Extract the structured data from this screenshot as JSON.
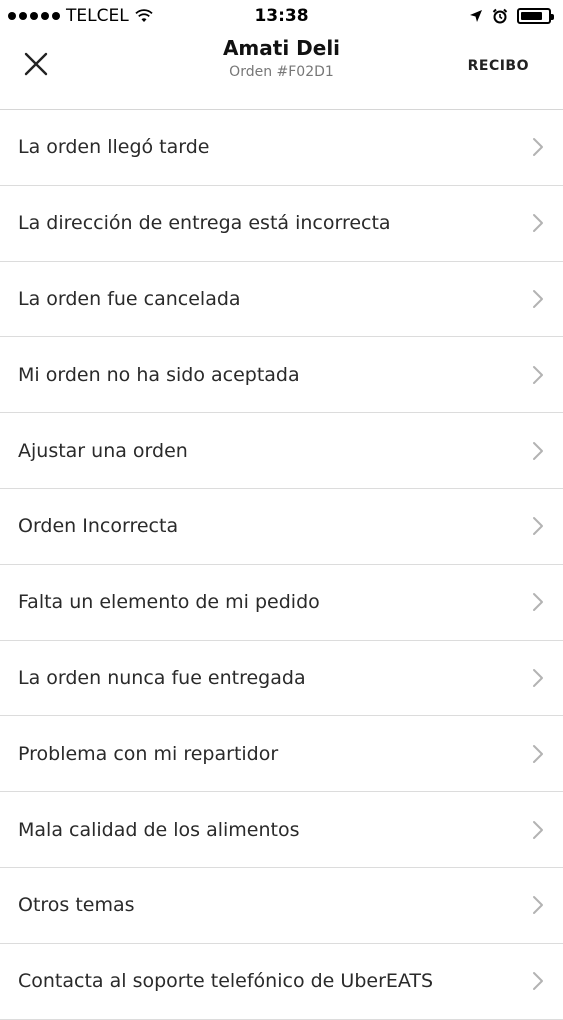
{
  "status_bar": {
    "carrier": "TELCEL",
    "time": "13:38",
    "battery_percent": 80
  },
  "header": {
    "title": "Amati Deli",
    "subtitle": "Orden #F02D1",
    "receipt_label": "RECIBO"
  },
  "issues": [
    "La orden llegó tarde",
    "La dirección de entrega está incorrecta",
    "La orden fue cancelada",
    "Mi orden no ha sido aceptada",
    "Ajustar una orden",
    "Orden Incorrecta",
    "Falta un elemento de mi pedido",
    "La orden nunca fue entregada",
    "Problema con mi repartidor",
    "Mala calidad de los alimentos",
    "Otros temas",
    "Contacta al soporte telefónico de UberEATS"
  ]
}
